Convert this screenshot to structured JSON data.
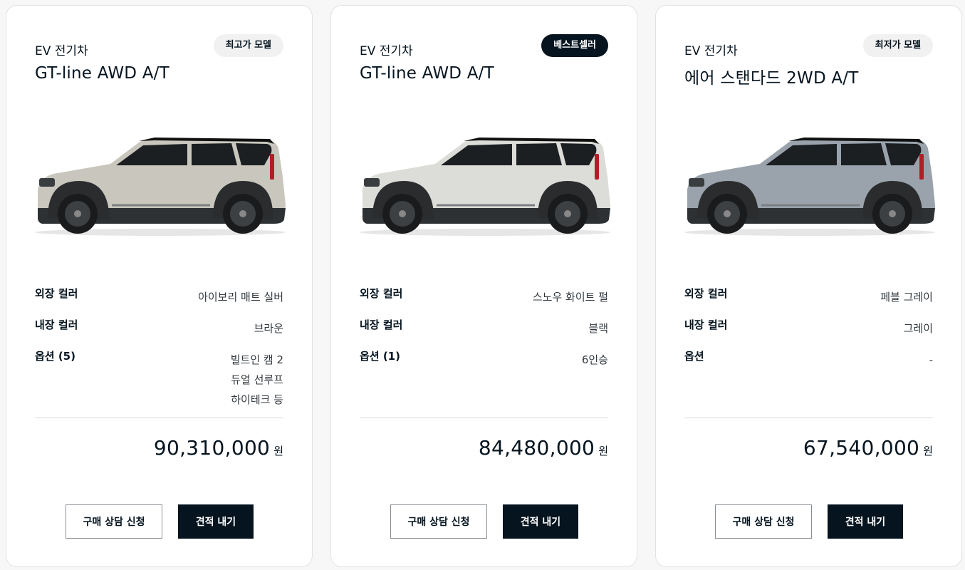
{
  "cards": [
    {
      "category": "EV 전기차",
      "trim": "GT-line AWD A/T",
      "badge": "최고가 모델",
      "badge_style": "light",
      "car_color": "#c9c7bd",
      "exterior_label": "외장 컬러",
      "exterior_value": "아이보리 매트 실버",
      "interior_label": "내장 컬러",
      "interior_value": "브라운",
      "options_label": "옵션 (5)",
      "options_values": [
        "빌트인 캠 2",
        "듀얼 선루프",
        "하이테크 등"
      ],
      "price": "90,310,000",
      "price_unit": "원",
      "consult_label": "구매 상담 신청",
      "quote_label": "견적 내기"
    },
    {
      "category": "EV 전기차",
      "trim": "GT-line AWD A/T",
      "badge": "베스트셀러",
      "badge_style": "dark",
      "car_color": "#dcdcd8",
      "exterior_label": "외장 컬러",
      "exterior_value": "스노우 화이트 펄",
      "interior_label": "내장 컬러",
      "interior_value": "블랙",
      "options_label": "옵션 (1)",
      "options_values": [
        "6인승"
      ],
      "price": "84,480,000",
      "price_unit": "원",
      "consult_label": "구매 상담 신청",
      "quote_label": "견적 내기"
    },
    {
      "category": "EV 전기차",
      "trim": "에어 스탠다드 2WD A/T",
      "badge": "최저가 모델",
      "badge_style": "light",
      "car_color": "#9aa3ab",
      "exterior_label": "외장 컬러",
      "exterior_value": "페블 그레이",
      "interior_label": "내장 컬러",
      "interior_value": "그레이",
      "options_label": "옵션",
      "options_values": [
        "-"
      ],
      "price": "67,540,000",
      "price_unit": "원",
      "consult_label": "구매 상담 신청",
      "quote_label": "견적 내기"
    }
  ]
}
